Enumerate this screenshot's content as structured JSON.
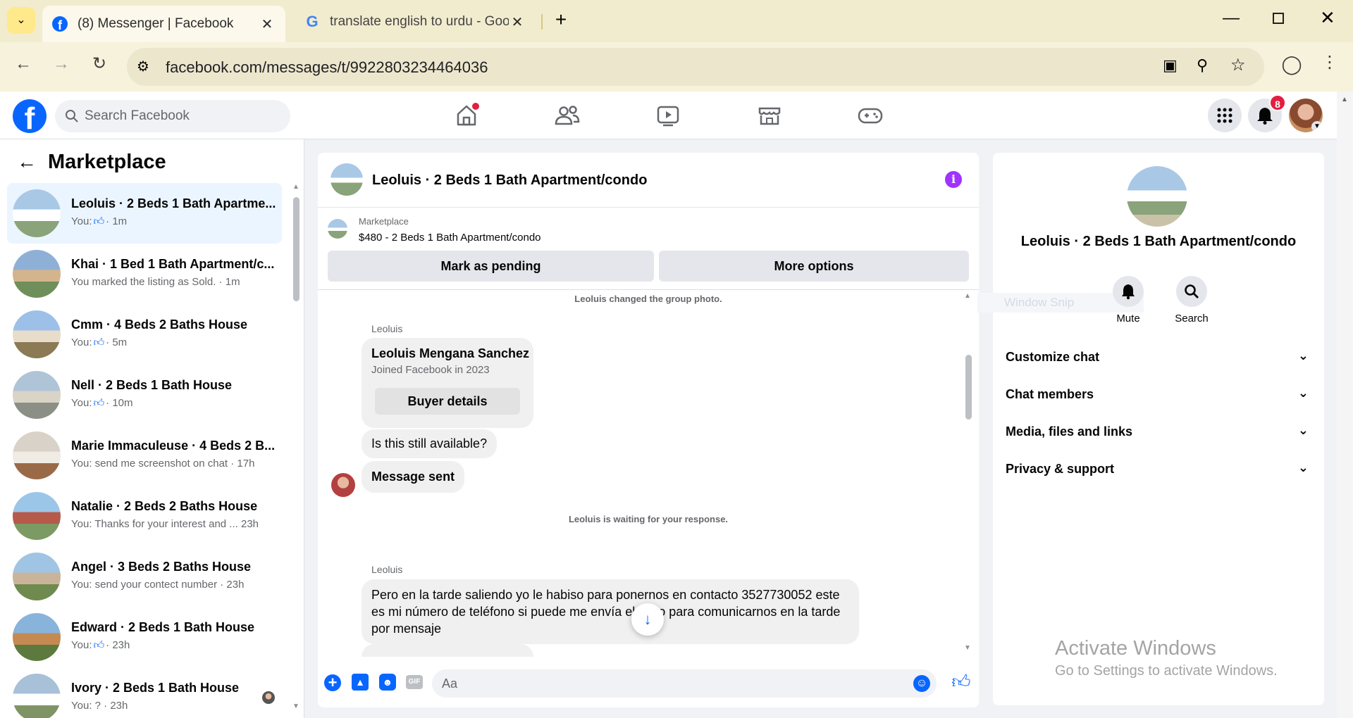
{
  "browser": {
    "tabs": [
      {
        "title": "(8) Messenger | Facebook",
        "icon": "facebook-icon"
      },
      {
        "title": "translate english to urdu - Goog",
        "icon": "google-icon"
      }
    ],
    "url": "facebook.com/messages/t/9922803234464036"
  },
  "fb": {
    "search_placeholder": "Search Facebook",
    "notifications_count": "8"
  },
  "left": {
    "title": "Marketplace",
    "conversations": [
      {
        "name": "Leoluis · 2 Beds 1 Bath Apartme...",
        "sub_prefix": "You:",
        "sub_like": true,
        "sub_time": "· 1m",
        "selected": true
      },
      {
        "name": "Khai · 1 Bed 1 Bath Apartment/c...",
        "sub_text": "You marked the listing as Sold. · 1m"
      },
      {
        "name": "Cmm · 4 Beds 2 Baths House",
        "sub_prefix": "You:",
        "sub_like": true,
        "sub_time": "· 5m"
      },
      {
        "name": "Nell · 2 Beds 1 Bath House",
        "sub_prefix": "You:",
        "sub_like": true,
        "sub_time": "· 10m"
      },
      {
        "name": "Marie Immaculeuse · 4 Beds 2 B...",
        "sub_text": "You: send me screenshot on chat · 17h"
      },
      {
        "name": "Natalie · 2 Beds 2 Baths House",
        "sub_text": "You: Thanks for your interest and ... 23h"
      },
      {
        "name": "Angel · 3 Beds 2 Baths House",
        "sub_text": "You: send your contect number · 23h"
      },
      {
        "name": "Edward · 2 Beds 1 Bath House",
        "sub_prefix": "You:",
        "sub_like": true,
        "sub_time": "· 23h"
      },
      {
        "name": "Ivory · 2 Beds 1 Bath House",
        "sub_text": "You: ? · 23h"
      }
    ]
  },
  "chat": {
    "title": "Leoluis · 2 Beds 1 Bath Apartment/condo",
    "listing_source": "Marketplace",
    "listing_title": "$480 - 2 Beds 1 Bath Apartment/condo",
    "mark_pending": "Mark as pending",
    "more_options": "More options",
    "sys_photo": "Leoluis changed the group photo.",
    "sender1": "Leoluis",
    "card_name": "Leoluis Mengana Sanchez",
    "card_joined": "Joined Facebook in 2023",
    "buyer_details": "Buyer details",
    "msg_available": "Is this still available?",
    "msg_sent": "Message sent",
    "sys_waiting": "Leoluis is waiting for your response.",
    "sender2": "Leoluis",
    "msg_long": "Pero en la tarde saliendo yo le habiso para ponernos en contacto 3527730052 este es mi número de teléfono si puede me envía el suyo para comunicarnos en la tarde por mensaje",
    "input_placeholder": "Aa"
  },
  "right": {
    "title": "Leoluis · 2 Beds 1 Bath Apartment/condo",
    "mute": "Mute",
    "search": "Search",
    "ghost": "Window Snip",
    "sections": [
      "Customize chat",
      "Chat members",
      "Media, files and links",
      "Privacy & support"
    ]
  },
  "watermark": {
    "line1": "Activate Windows",
    "line2": "Go to Settings to activate Windows."
  },
  "colors": {
    "fb_blue": "#0866ff",
    "accent_purple": "#a033ff",
    "notif_red": "#e41e3f"
  }
}
